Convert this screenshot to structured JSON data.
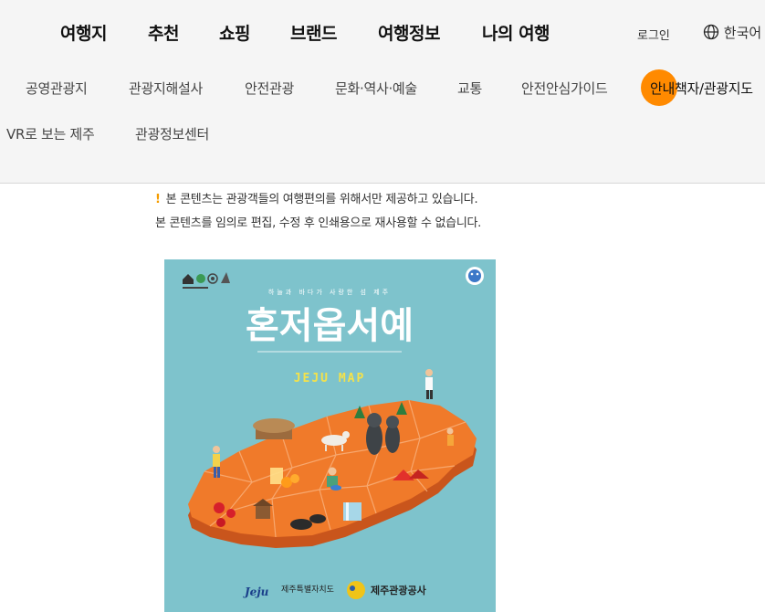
{
  "main_nav": [
    "여행지",
    "추천",
    "쇼핑",
    "브랜드",
    "여행정보",
    "나의 여행"
  ],
  "login": "로그인",
  "language": "한국어",
  "sub_nav": [
    "공영관광지",
    "관광지해설사",
    "안전관광",
    "문화·역사·예술",
    "교통",
    "안전안심가이드",
    "안내책자/관광지도",
    "VR로 보는 제주",
    "관광정보센터"
  ],
  "notice": {
    "line1": "본 콘텐츠는 관광객들의 여행편의를 위해서만 제공하고 있습니다.",
    "line2": "본 콘텐츠를 임의로 편집, 수정 후 인쇄용으로 재사용할 수 없습니다."
  },
  "cover": {
    "tagline": "하늘과 바다가 사랑한 섬 제주",
    "title": "혼저옵서예",
    "subtitle": "JEJU MAP",
    "publisher1_logo": "Jeju",
    "publisher1": "제주특별자치도",
    "publisher2": "제주관광공사"
  },
  "colors": {
    "accent": "#ff8a00",
    "cover_bg": "#7ec3cc",
    "map_orange": "#f07a2a"
  }
}
